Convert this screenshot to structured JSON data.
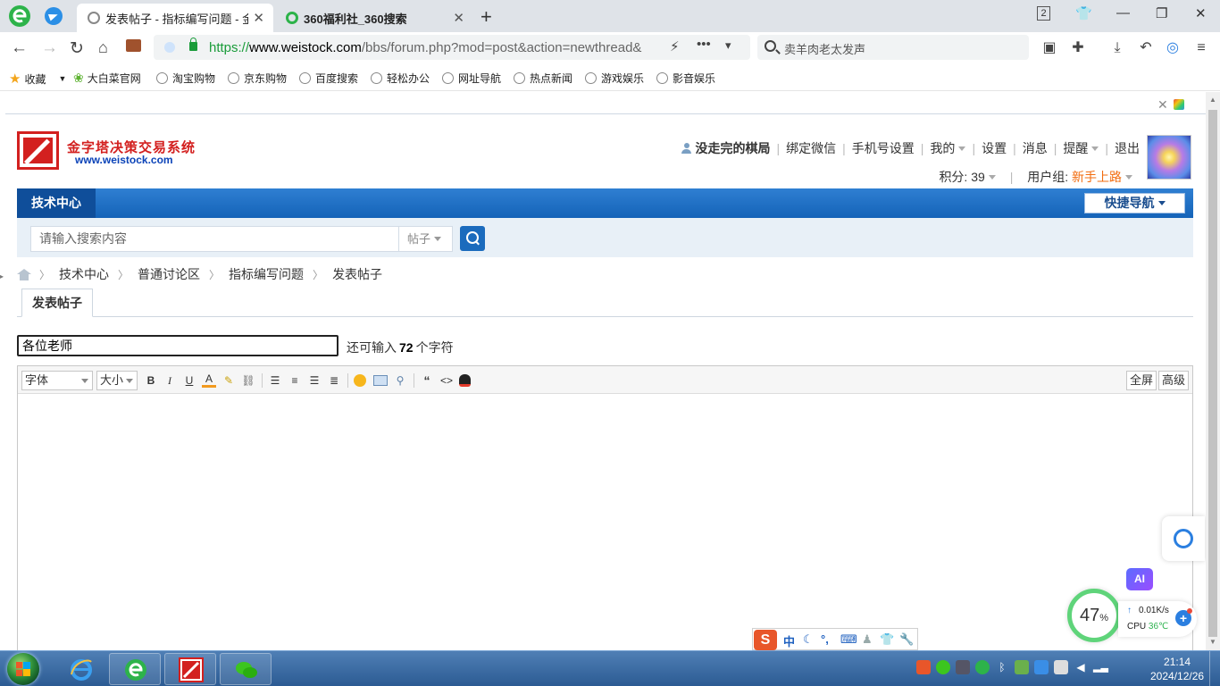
{
  "browser": {
    "tabs": [
      {
        "title": "发表帖子 - 指标编写问题 - 金",
        "active": true
      },
      {
        "title": "360福利社_360搜索",
        "active": false
      }
    ],
    "tab_count": "2",
    "url": {
      "scheme": "https://",
      "host": "www.weistock.com",
      "path": "/bbs/forum.php?mod=post&action=newthread&"
    },
    "search_placeholder": "卖羊肉老太发声",
    "bookmarks": [
      {
        "label": "收藏"
      },
      {
        "label": "大白菜官网"
      },
      {
        "label": "淘宝购物"
      },
      {
        "label": "京东购物"
      },
      {
        "label": "百度搜索"
      },
      {
        "label": "轻松办公"
      },
      {
        "label": "网址导航"
      },
      {
        "label": "热点新闻"
      },
      {
        "label": "游戏娱乐"
      },
      {
        "label": "影音娱乐"
      }
    ]
  },
  "site": {
    "name": "金字塔决策交易系统",
    "url": "www.weistock.com",
    "brand_color": "#d3201f"
  },
  "user": {
    "name": "没走完的棋局",
    "nav": [
      "绑定微信",
      "手机号设置",
      "我的",
      "设置",
      "消息",
      "提醒",
      "退出"
    ],
    "points_label": "积分: 39",
    "group_label": "用户组:",
    "group_value": "新手上路"
  },
  "nav": {
    "current": "技术中心",
    "quick_nav": "快捷导航"
  },
  "search": {
    "placeholder": "请输入搜索内容",
    "type": "帖子"
  },
  "breadcrumb": [
    "技术中心",
    "普通讨论区",
    "指标编写问题",
    "发表帖子"
  ],
  "post": {
    "tab_label": "发表帖子",
    "title_value": "各位老师",
    "hint_prefix": "还可输入",
    "hint_count": "72",
    "hint_suffix": "个字符"
  },
  "editor": {
    "font_label": "字体",
    "size_label": "大小",
    "fullscreen": "全屏",
    "advanced": "高级"
  },
  "widgets": {
    "ai": "AI",
    "cpu_percent": "47",
    "net_speed": "0.01K/s",
    "cpu_label": "CPU",
    "cpu_temp": "36℃"
  },
  "ime": {
    "mode": "中"
  },
  "taskbar": {
    "time": "21:14",
    "date": "2024/12/26"
  }
}
